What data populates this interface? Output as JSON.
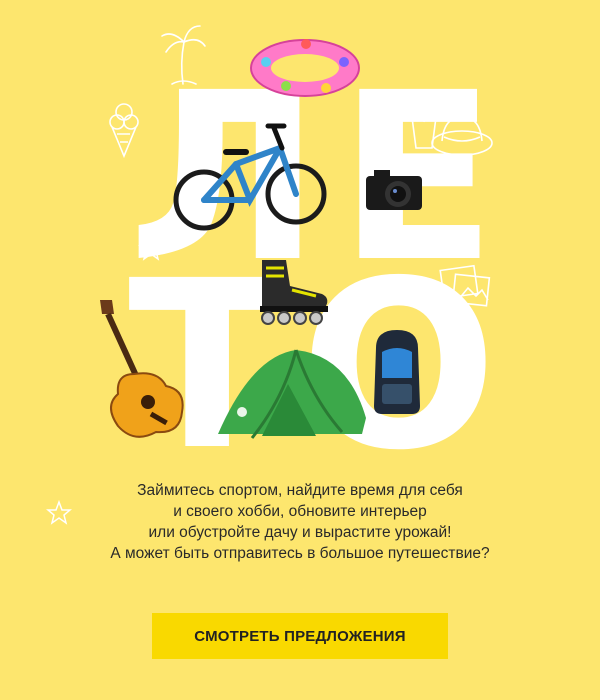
{
  "hero": {
    "letters": [
      "Л",
      "Е",
      "Т",
      "О"
    ]
  },
  "body_text": {
    "line1": "Займитесь спортом, найдите время для себя",
    "line2": "и своего хобби, обновите интерьер",
    "line3": "или обустройте дачу и вырастите урожай!",
    "line4": "А может быть отправитесь в большое путешествие?"
  },
  "cta": {
    "label": "СМОТРЕТЬ ПРЕДЛОЖЕНИЯ"
  },
  "colors": {
    "background": "#fde66e",
    "button": "#f9d900",
    "letters": "#ffffff"
  },
  "products": [
    "pool-ring",
    "bicycle",
    "camera",
    "inline-skate",
    "guitar",
    "tent",
    "backpack"
  ],
  "decor_icons": [
    "palm-tree-icon",
    "ice-cream-icon",
    "cocktail-icon",
    "sun-hat-icon",
    "star-icon",
    "photos-icon"
  ]
}
